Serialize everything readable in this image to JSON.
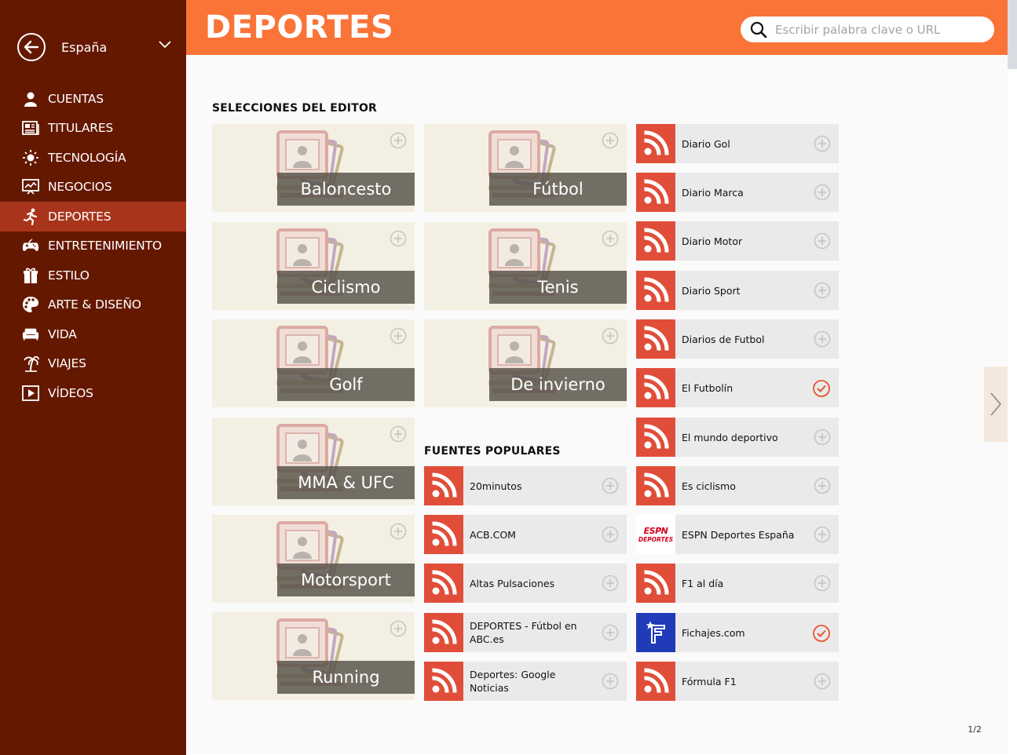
{
  "sidebar": {
    "region_label": "España",
    "items": [
      {
        "label": "CUENTAS",
        "icon": "user-icon",
        "active": false
      },
      {
        "label": "TITULARES",
        "icon": "newspaper-icon",
        "active": false
      },
      {
        "label": "TECNOLOGÍA",
        "icon": "bulb-icon",
        "active": false
      },
      {
        "label": "NEGOCIOS",
        "icon": "chart-icon",
        "active": false
      },
      {
        "label": "DEPORTES",
        "icon": "runner-icon",
        "active": true
      },
      {
        "label": "ENTRETENIMIENTO",
        "icon": "gamepad-icon",
        "active": false
      },
      {
        "label": "ESTILO",
        "icon": "gift-icon",
        "active": false
      },
      {
        "label": "ARTE & DISEÑO",
        "icon": "palette-icon",
        "active": false
      },
      {
        "label": "VIDA",
        "icon": "sofa-icon",
        "active": false
      },
      {
        "label": "VIAJES",
        "icon": "palm-icon",
        "active": false
      },
      {
        "label": "VÍDEOS",
        "icon": "play-icon",
        "active": false
      }
    ]
  },
  "header": {
    "title": "DEPORTES",
    "search_placeholder": "Escribir palabra clave o URL"
  },
  "editor": {
    "title": "SELECCIONES DEL EDITOR",
    "tiles": [
      {
        "label": "Baloncesto"
      },
      {
        "label": "Fútbol"
      },
      {
        "label": "Ciclismo"
      },
      {
        "label": "Tenis"
      },
      {
        "label": "Golf"
      },
      {
        "label": "De invierno"
      },
      {
        "label": "MMA & UFC"
      },
      {
        "label": "Motorsport"
      },
      {
        "label": "Running"
      }
    ]
  },
  "popular": {
    "title": "FUENTES POPULARES",
    "col2": [
      {
        "name": "20minutos",
        "icon": "rss",
        "subscribed": false
      },
      {
        "name": "ACB.COM",
        "icon": "rss",
        "subscribed": false
      },
      {
        "name": "Altas Pulsaciones",
        "icon": "rss",
        "subscribed": false
      },
      {
        "name": "DEPORTES - Fútbol en ABC.es",
        "icon": "rss",
        "subscribed": false
      },
      {
        "name": "Deportes: Google Noticias",
        "icon": "rss",
        "subscribed": false
      }
    ],
    "col3": [
      {
        "name": "Diario Gol",
        "icon": "rss",
        "subscribed": false
      },
      {
        "name": "Diario Marca",
        "icon": "rss",
        "subscribed": false
      },
      {
        "name": "Diario Motor",
        "icon": "rss",
        "subscribed": false
      },
      {
        "name": "Diario Sport",
        "icon": "rss",
        "subscribed": false
      },
      {
        "name": "Diarios de Futbol",
        "icon": "rss",
        "subscribed": false
      },
      {
        "name": "El Futbolín",
        "icon": "rss",
        "subscribed": true
      },
      {
        "name": "El mundo deportivo",
        "icon": "rss",
        "subscribed": false
      },
      {
        "name": "Es ciclismo",
        "icon": "rss",
        "subscribed": false
      },
      {
        "name": "ESPN Deportes España",
        "icon": "espn",
        "logo_text": "ESPN DEPORTES",
        "subscribed": false
      },
      {
        "name": "F1 al día",
        "icon": "rss",
        "subscribed": false
      },
      {
        "name": "Fichajes.com",
        "icon": "fichajes",
        "subscribed": true
      },
      {
        "name": "Fórmula F1",
        "icon": "rss",
        "subscribed": false
      }
    ]
  },
  "pager": "1/2",
  "colors": {
    "sidebar_bg": "#651800",
    "sidebar_active": "#a8351b",
    "header_bg": "#fa7337",
    "rss_bg": "#e04e39",
    "check_color": "#e8542c"
  }
}
